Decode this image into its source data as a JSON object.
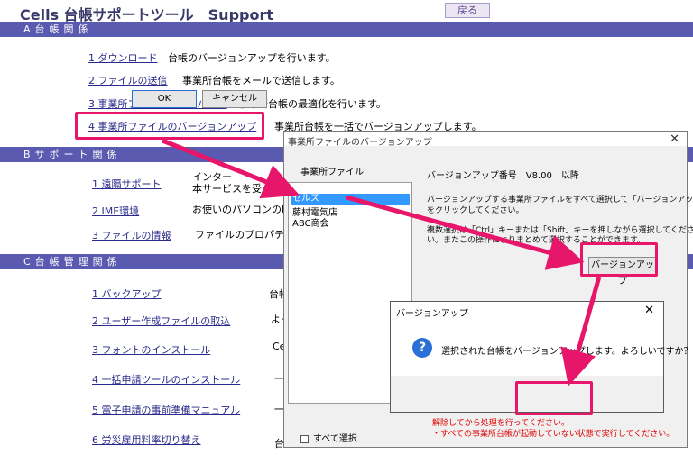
{
  "app": {
    "title": "Cells 台帳サポートツール　Support",
    "back_label": "戻る"
  },
  "sections": {
    "a": "A台帳関係",
    "b": "Bサポート関係",
    "c": "C台帳管理関係"
  },
  "menu_a": [
    {
      "label": "1 ダウンロード",
      "desc": "台帳のバージョンアップを行います。"
    },
    {
      "label": "2 ファイルの送信",
      "desc": "事業所台帳をメールで送信します。"
    },
    {
      "label": "3 事業所ファイルのコンバート",
      "desc": "事業所台帳の最適化を行います。"
    },
    {
      "label": "4 事業所ファイルのバージョンアップ",
      "desc": "事業所台帳を一括でバージョンアップします。"
    }
  ],
  "menu_b": [
    {
      "label": "1 遠隔サポート",
      "desc": "インター",
      "desc2": "本サービスを受"
    },
    {
      "label": "2 IME環境",
      "desc": "お使いのパソコンのIM"
    },
    {
      "label": "3 ファイルの情報",
      "desc": "ファイルのプロパティを"
    }
  ],
  "menu_c": [
    {
      "label": "1 バックアップ",
      "desc": "台帳"
    },
    {
      "label": "2 ユーザー作成ファイルの取込",
      "desc": "よく"
    },
    {
      "label": "3 フォントのインストール",
      "desc": "Ce"
    },
    {
      "label": "4 一括申請ツールのインストール",
      "desc": "一"
    },
    {
      "label": "5 電子申請の事前準備マニュアル",
      "desc": "一"
    },
    {
      "label": "6 労災雇用料率切り替え",
      "desc": "台"
    }
  ],
  "dialog1": {
    "title": "事業所ファイルのバージョンアップ",
    "close": "✕",
    "list_label": "事業所ファイル",
    "files": [
      "セルズ",
      "藤村電気店",
      "ABC商会"
    ],
    "version": "バージョンアップ番号　V8.00　以降",
    "text1": "バージョンアップする事業所ファイルをすべて選択して「バージョンアップ」",
    "text2": "をクリックしてください。",
    "text3": "複数選択は「Ctrl」キーまたは「Shift」キーを押しながら選択してくださ",
    "text4": "い。またこの操作によりまとめて選択することができます。",
    "button": "バージョンアップ",
    "select_all": "すべて選択",
    "foot1": "解除してから処理を行ってください。",
    "foot2": "・すべての事業所台帳が起動していない状態で実行してください。"
  },
  "dialog2": {
    "title": "バージョンアップ",
    "close": "✕",
    "icon": "?",
    "message": "選択された台帳をバージョンアップします。よろしいですか？",
    "ok": "OK",
    "cancel": "キャンセル"
  },
  "colors": {
    "section_bar": "#5a5ab0",
    "highlight": "#e8166a",
    "link": "#2a2a8a"
  }
}
